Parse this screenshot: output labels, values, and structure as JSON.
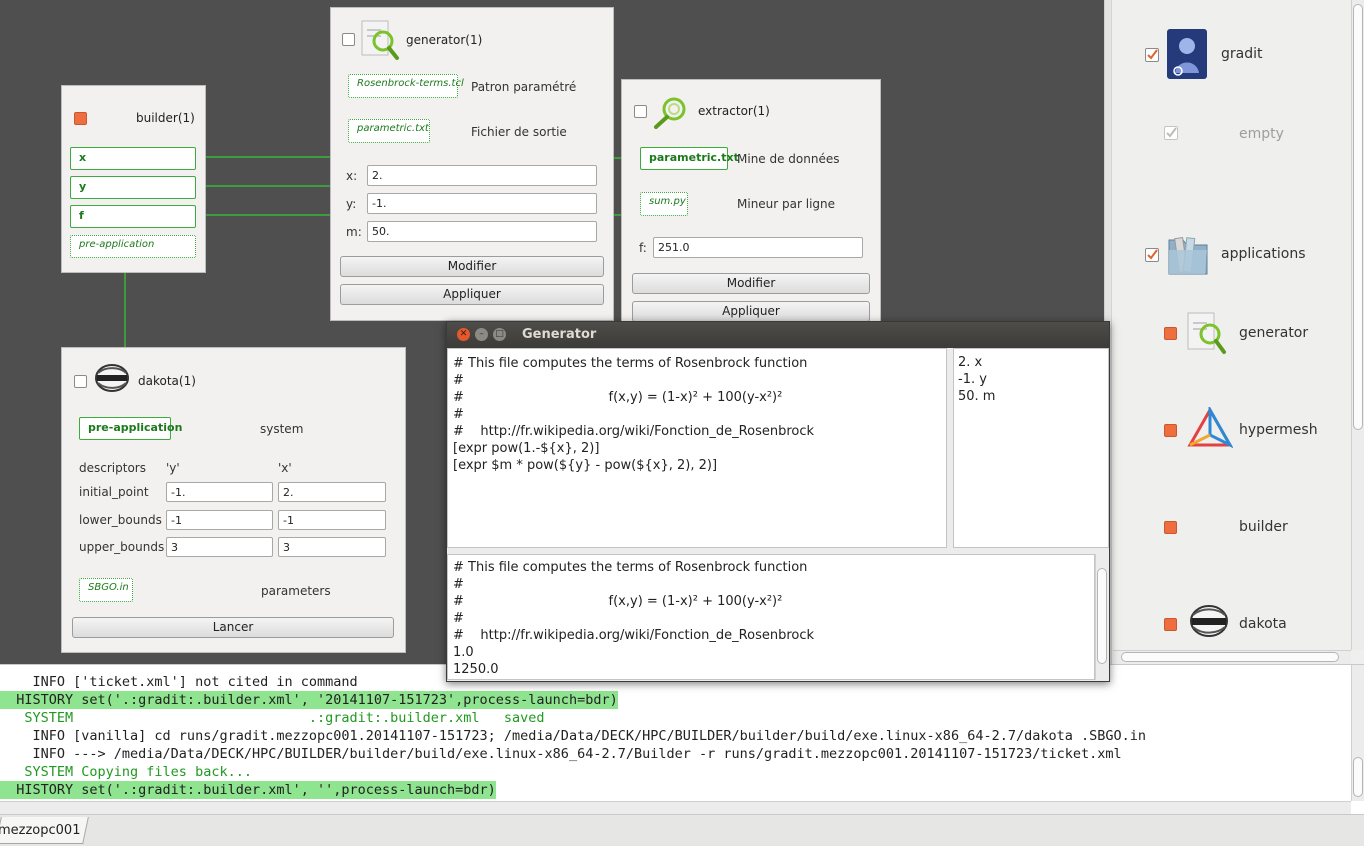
{
  "builder": {
    "title": "builder(1)",
    "ports": [
      "x",
      "y",
      "f"
    ],
    "pre_app": "pre-application"
  },
  "generator_node": {
    "title": "generator(1)",
    "template_file": "Rosenbrock-terms.tcl",
    "template_label": "Patron paramétré",
    "output_file": "parametric.txt",
    "output_label": "Fichier de sortie",
    "fields": [
      {
        "label": "x:",
        "value": "2."
      },
      {
        "label": "y:",
        "value": "-1."
      },
      {
        "label": "m:",
        "value": "50."
      }
    ],
    "modify": "Modifier",
    "apply": "Appliquer"
  },
  "extractor_node": {
    "title": "extractor(1)",
    "input_file": "parametric.txt",
    "input_label": "Mine de données",
    "miner_file": "sum.py",
    "miner_label": "Mineur par ligne",
    "f_label": "f:",
    "f_value": "251.0",
    "modify": "Modifier",
    "apply": "Appliquer"
  },
  "dakota_node": {
    "title": "dakota(1)",
    "pre_app": "pre-application",
    "system_label": "system",
    "descriptors_label": "descriptors",
    "col_y": "'y'",
    "col_x": "'x'",
    "rows": [
      {
        "label": "initial_point",
        "y": "-1.",
        "x": "2."
      },
      {
        "label": "lower_bounds",
        "y": "-1",
        "x": "-1"
      },
      {
        "label": "upper_bounds",
        "y": "3",
        "x": "3"
      }
    ],
    "params_file": "SBGO.in",
    "params_label": "parameters",
    "launch": "Lancer"
  },
  "right_panel": {
    "items": [
      {
        "label": "gradit",
        "checked": true
      },
      {
        "label": "empty",
        "checked": true,
        "disabled": true
      },
      {
        "label": "applications",
        "checked": true
      },
      {
        "label": "generator"
      },
      {
        "label": "hypermesh"
      },
      {
        "label": "builder"
      },
      {
        "label": "dakota"
      }
    ]
  },
  "generator_window": {
    "title": "Generator",
    "template_lines": [
      "# This file computes the terms of Rosenbrock function",
      "#",
      "#                                   f(x,y) = (1-x)² + 100(y-x²)²",
      "#",
      "#    http://fr.wikipedia.org/wiki/Fonction_de_Rosenbrock",
      "[expr pow(1.-${x}, 2)]",
      "[expr $m * pow(${y} - pow(${x}, 2), 2)]"
    ],
    "values_lines": [
      "2. x",
      "-1. y",
      "50. m"
    ],
    "output_lines": [
      "# This file computes the terms of Rosenbrock function",
      "#",
      "#                                   f(x,y) = (1-x)² + 100(y-x²)²",
      "#",
      "#    http://fr.wikipedia.org/wiki/Fonction_de_Rosenbrock",
      "1.0",
      "1250.0"
    ]
  },
  "console": {
    "lines": [
      {
        "text": "    INFO ['ticket.xml'] not cited in command",
        "kind": "info"
      },
      {
        "text": "  HISTORY set('.:gradit:.builder.xml', '20141107-151723',process-launch=bdr)",
        "kind": "history"
      },
      {
        "text": "   SYSTEM                             .:gradit:.builder.xml   saved",
        "kind": "system"
      },
      {
        "text": "    INFO [vanilla] cd runs/gradit.mezzopc001.20141107-151723; /media/Data/DECK/HPC/BUILDER/builder/build/exe.linux-x86_64-2.7/dakota .SBGO.in",
        "kind": "info"
      },
      {
        "text": "    INFO ---> /media/Data/DECK/HPC/BUILDER/builder/build/exe.linux-x86_64-2.7/Builder -r runs/gradit.mezzopc001.20141107-151723/ticket.xml",
        "kind": "info"
      },
      {
        "text": "   SYSTEM Copying files back...",
        "kind": "system"
      },
      {
        "text": "  HISTORY set('.:gradit:.builder.xml', '',process-launch=bdr)",
        "kind": "history"
      }
    ]
  },
  "tab": {
    "label": "mezzopc001"
  },
  "colors": {
    "wire": "#33cc33",
    "canvas": "#4f4f4f",
    "history_highlight": "#8fe48f",
    "system_text": "#1f9a1f"
  }
}
